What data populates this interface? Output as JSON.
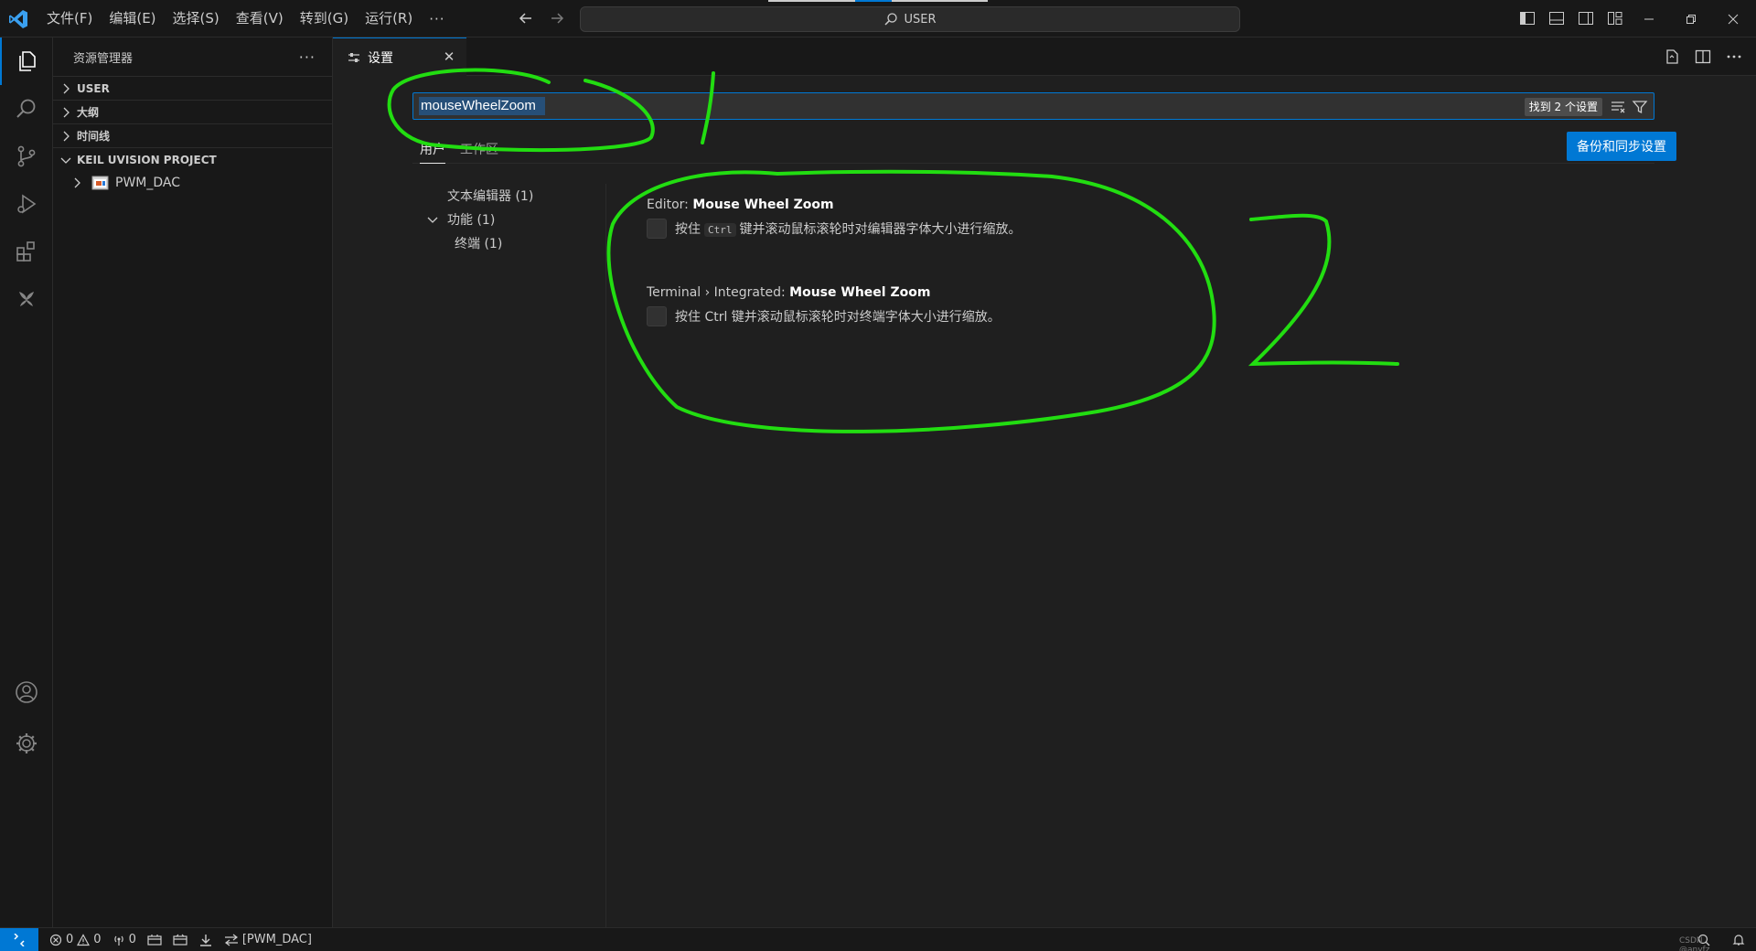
{
  "titlebar": {
    "menu": [
      "文件(F)",
      "编辑(E)",
      "选择(S)",
      "查看(V)",
      "转到(G)",
      "运行(R)"
    ],
    "more": "···",
    "command_center": "USER"
  },
  "sidebar": {
    "title": "资源管理器",
    "more": "···",
    "sections": [
      "USER",
      "大纲",
      "时间线",
      "KEIL UVISION PROJECT"
    ],
    "project_item": "PWM_DAC"
  },
  "editor": {
    "tab_label": "设置",
    "search_value": "mouseWheelZoom",
    "found_badge": "找到 2 个设置",
    "scope_tabs": [
      "用户",
      "工作区"
    ],
    "sync_button": "备份和同步设置",
    "toc": [
      {
        "label": "文本编辑器 (1)",
        "expandable": false
      },
      {
        "label": "功能 (1)",
        "expandable": true
      },
      {
        "label": "终端 (1)",
        "expandable": false
      }
    ],
    "settings": [
      {
        "category": "Editor: ",
        "name": "Mouse Wheel Zoom",
        "desc_before": "按住",
        "desc_code": "Ctrl",
        "desc_after": "键并滚动鼠标滚轮时对编辑器字体大小进行缩放。",
        "checked": false
      },
      {
        "category": "Terminal › Integrated: ",
        "name": "Mouse Wheel Zoom",
        "desc": "按住 Ctrl 键并滚动鼠标滚轮时对终端字体大小进行缩放。",
        "checked": false
      }
    ]
  },
  "statusbar": {
    "errors": "0",
    "warnings": "0",
    "ports": "0",
    "project": "[PWM_DAC]",
    "watermark": "CSDN @anyfz"
  },
  "colors": {
    "accent": "#0078d4",
    "annotation": "#22dd11"
  }
}
